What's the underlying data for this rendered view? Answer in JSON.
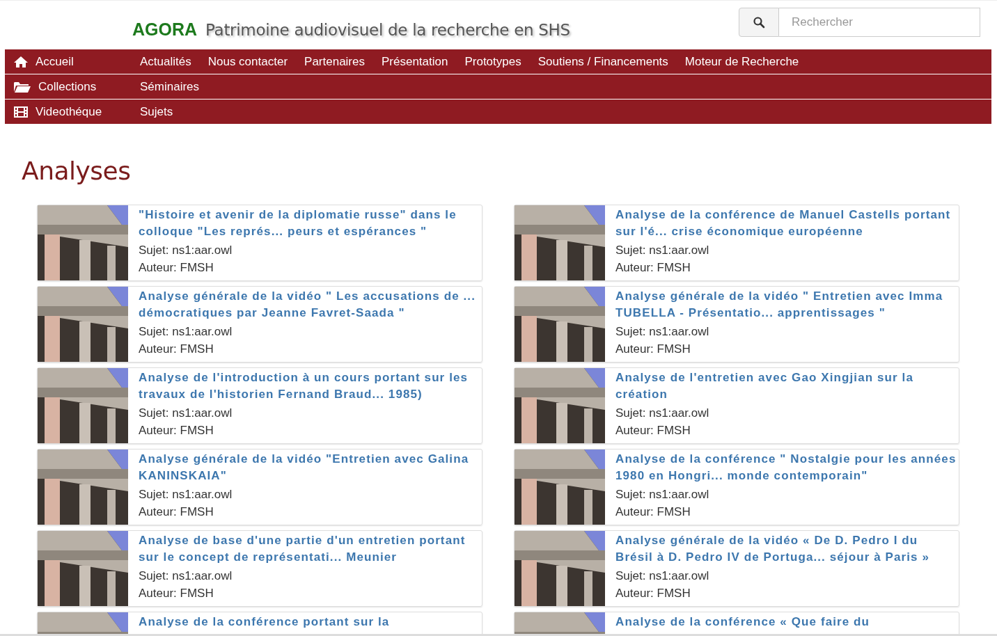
{
  "header": {
    "logo": "AGORA",
    "tagline": "Patrimoine audiovisuel de la recherche en SHS",
    "search": {
      "placeholder": "Rechercher"
    }
  },
  "nav": [
    {
      "label": "Accueil",
      "links": [
        "Actualités",
        "Nous contacter",
        "Partenaires",
        "Présentation",
        "Prototypes",
        "Soutiens / Financements",
        "Moteur de Recherche"
      ]
    },
    {
      "label": "Collections",
      "links": [
        "Séminaires"
      ]
    },
    {
      "label": "Videothéque",
      "links": [
        "Sujets"
      ]
    }
  ],
  "page_title": "Analyses",
  "items": [
    {
      "title": "\"Histoire et avenir de la diplomatie russe\" dans le colloque \"Les représ... peurs et espérances \"",
      "subject": "Sujet: ns1:aar.owl",
      "author": "Auteur: FMSH"
    },
    {
      "title": "Analyse de la conférence de Manuel Castells portant sur l'é... crise économique européenne",
      "subject": "Sujet: ns1:aar.owl",
      "author": "Auteur: FMSH"
    },
    {
      "title": "Analyse générale de la vidéo \" Les accusations de ... démocratiques par Jeanne Favret-Saada \"",
      "subject": "Sujet: ns1:aar.owl",
      "author": "Auteur: FMSH"
    },
    {
      "title": "Analyse générale de la vidéo \" Entretien avec Imma TUBELLA - Présentatio... apprentissages \"",
      "subject": "Sujet: ns1:aar.owl",
      "author": "Auteur: FMSH"
    },
    {
      "title": "Analyse de l'introduction à un cours portant sur les travaux de l'historien Fernand Braud... 1985)",
      "subject": "Sujet: ns1:aar.owl",
      "author": "Auteur: FMSH"
    },
    {
      "title": "Analyse de l'entretien avec Gao Xingjian sur la création",
      "subject": "Sujet: ns1:aar.owl",
      "author": "Auteur: FMSH"
    },
    {
      "title": "Analyse générale de la vidéo \"Entretien avec Galina KANINSKAIA\"",
      "subject": "Sujet: ns1:aar.owl",
      "author": "Auteur: FMSH"
    },
    {
      "title": "Analyse de la conférence \" Nostalgie pour les années 1980 en Hongri... monde contemporain\"",
      "subject": "Sujet: ns1:aar.owl",
      "author": "Auteur: FMSH"
    },
    {
      "title": "Analyse de base d'une partie d'un entretien portant sur le concept de représentati... Meunier",
      "subject": "Sujet: ns1:aar.owl",
      "author": "Auteur: FMSH"
    },
    {
      "title": "Analyse générale de la vidéo « De D. Pedro I du Brésil à D. Pedro IV de Portuga... séjour à Paris »",
      "subject": "Sujet: ns1:aar.owl",
      "author": "Auteur: FMSH"
    },
    {
      "title": "Analyse de la conférence portant sur la"
    },
    {
      "title": "Analyse de la conférence « Que faire du"
    }
  ]
}
